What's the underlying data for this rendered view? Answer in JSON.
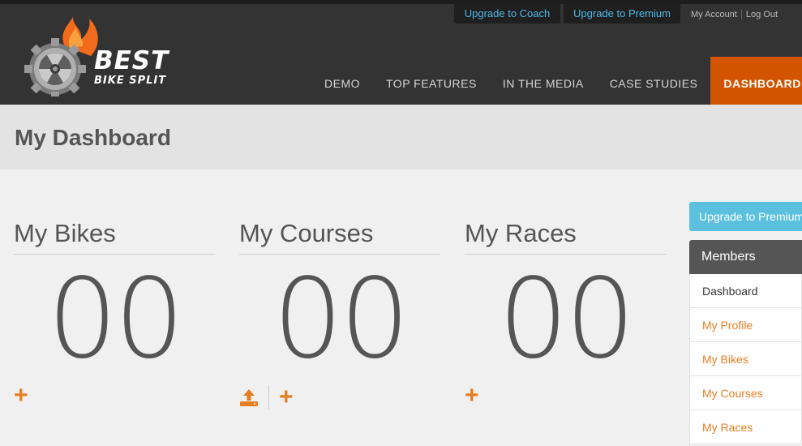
{
  "top_links": {
    "upgrade_coach": "Upgrade to Coach",
    "upgrade_premium": "Upgrade to Premium",
    "my_account": "My Account",
    "log_out": "Log Out"
  },
  "logo": {
    "line1": "BEST",
    "line2": "BIKE SPLIT"
  },
  "nav": {
    "items": [
      {
        "label": "DEMO"
      },
      {
        "label": "TOP FEATURES"
      },
      {
        "label": "IN THE MEDIA"
      },
      {
        "label": "CASE STUDIES"
      },
      {
        "label": "DASHBOARD",
        "active": true
      }
    ]
  },
  "page_title": "My Dashboard",
  "stats": [
    {
      "title": "My Bikes",
      "count": "00"
    },
    {
      "title": "My Courses",
      "count": "00"
    },
    {
      "title": "My Races",
      "count": "00"
    }
  ],
  "sidebar": {
    "upgrade_label": "Upgrade to Premium",
    "members_heading": "Members",
    "items": [
      {
        "label": "Dashboard"
      },
      {
        "label": "My Profile"
      },
      {
        "label": "My Bikes"
      },
      {
        "label": "My Courses"
      },
      {
        "label": "My Races"
      }
    ]
  },
  "colors": {
    "header_bg": "#333333",
    "accent_orange": "#d35400",
    "link_orange": "#e67e22",
    "upgrade_blue": "#5bc0de"
  },
  "icons": {
    "add": "plus-icon",
    "upload": "upload-icon",
    "logo": "gear-flame-logo"
  }
}
